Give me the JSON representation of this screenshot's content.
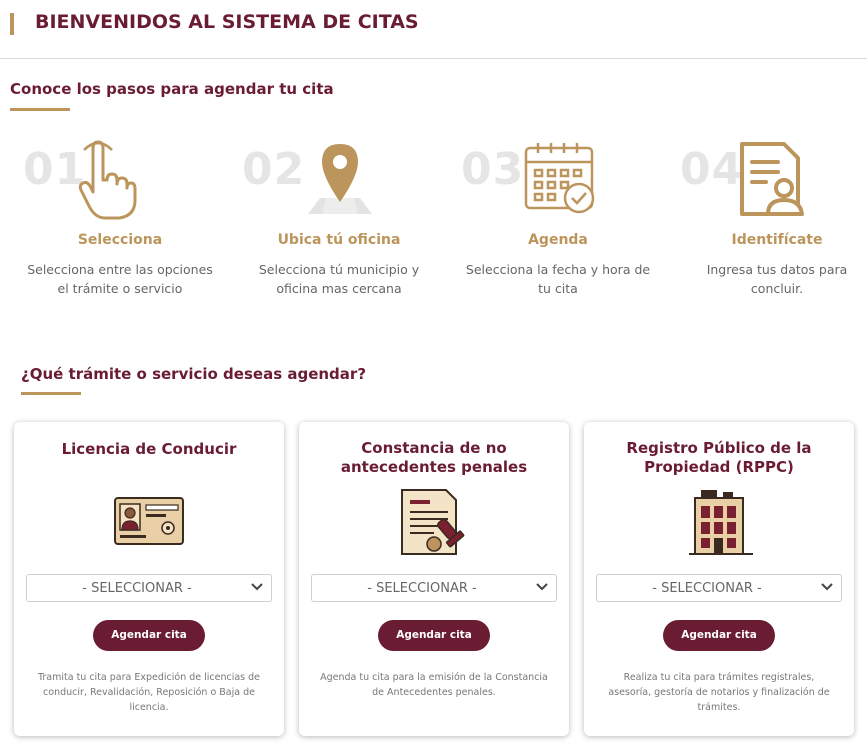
{
  "header": {
    "title": "BIENVENIDOS AL SISTEMA DE CITAS"
  },
  "steps_section": {
    "title": "Conoce los pasos para agendar tu cita"
  },
  "steps": [
    {
      "number": "01",
      "title": "Selecciona",
      "desc_l1": "Selecciona entre las opciones",
      "desc_l2": "el trámite o servicio",
      "icon": "pointing-hand-icon"
    },
    {
      "number": "02",
      "title": "Ubica tú oficina",
      "desc_l1": "Selecciona tú municipio y",
      "desc_l2": "oficina mas cercana",
      "icon": "map-pin-icon"
    },
    {
      "number": "03",
      "title": "Agenda",
      "desc_l1": "Selecciona la fecha y hora de",
      "desc_l2": "tu cita",
      "icon": "calendar-check-icon"
    },
    {
      "number": "04",
      "title": "Identifícate",
      "desc_l1": "Ingresa tus datos para",
      "desc_l2": "concluir.",
      "icon": "id-document-icon"
    }
  ],
  "services_section": {
    "title": "¿Qué trámite o servicio deseas agendar?"
  },
  "services": [
    {
      "title_l1": "Licencia de Conducir",
      "title_l2": "",
      "select_placeholder": "- SELECCIONAR -",
      "button": "Agendar cita",
      "desc_l1": "Tramita tu cita para Expedición de licencias de",
      "desc_l2": "conducir, Revalidación, Reposición o Baja de",
      "desc_l3": "licencia.",
      "icon": "drivers-license-icon"
    },
    {
      "title_l1": "Constancia de no",
      "title_l2": "antecedentes penales",
      "select_placeholder": "- SELECCIONAR -",
      "button": "Agendar cita",
      "desc_l1": "Agenda tu cita para la emisión de la Constancia",
      "desc_l2": "de Antecedentes penales.",
      "desc_l3": "",
      "icon": "stamped-document-icon"
    },
    {
      "title_l1": "Registro Público de la",
      "title_l2": "Propiedad (RPPC)",
      "select_placeholder": "- SELECCIONAR -",
      "button": "Agendar cita",
      "desc_l1": "Realiza tu cita para trámites registrales,",
      "desc_l2": "asesoría, gestoría de notarios y finalización de",
      "desc_l3": "trámites.",
      "icon": "building-icon"
    }
  ],
  "colors": {
    "primary": "#691c32",
    "accent": "#bc955c"
  }
}
